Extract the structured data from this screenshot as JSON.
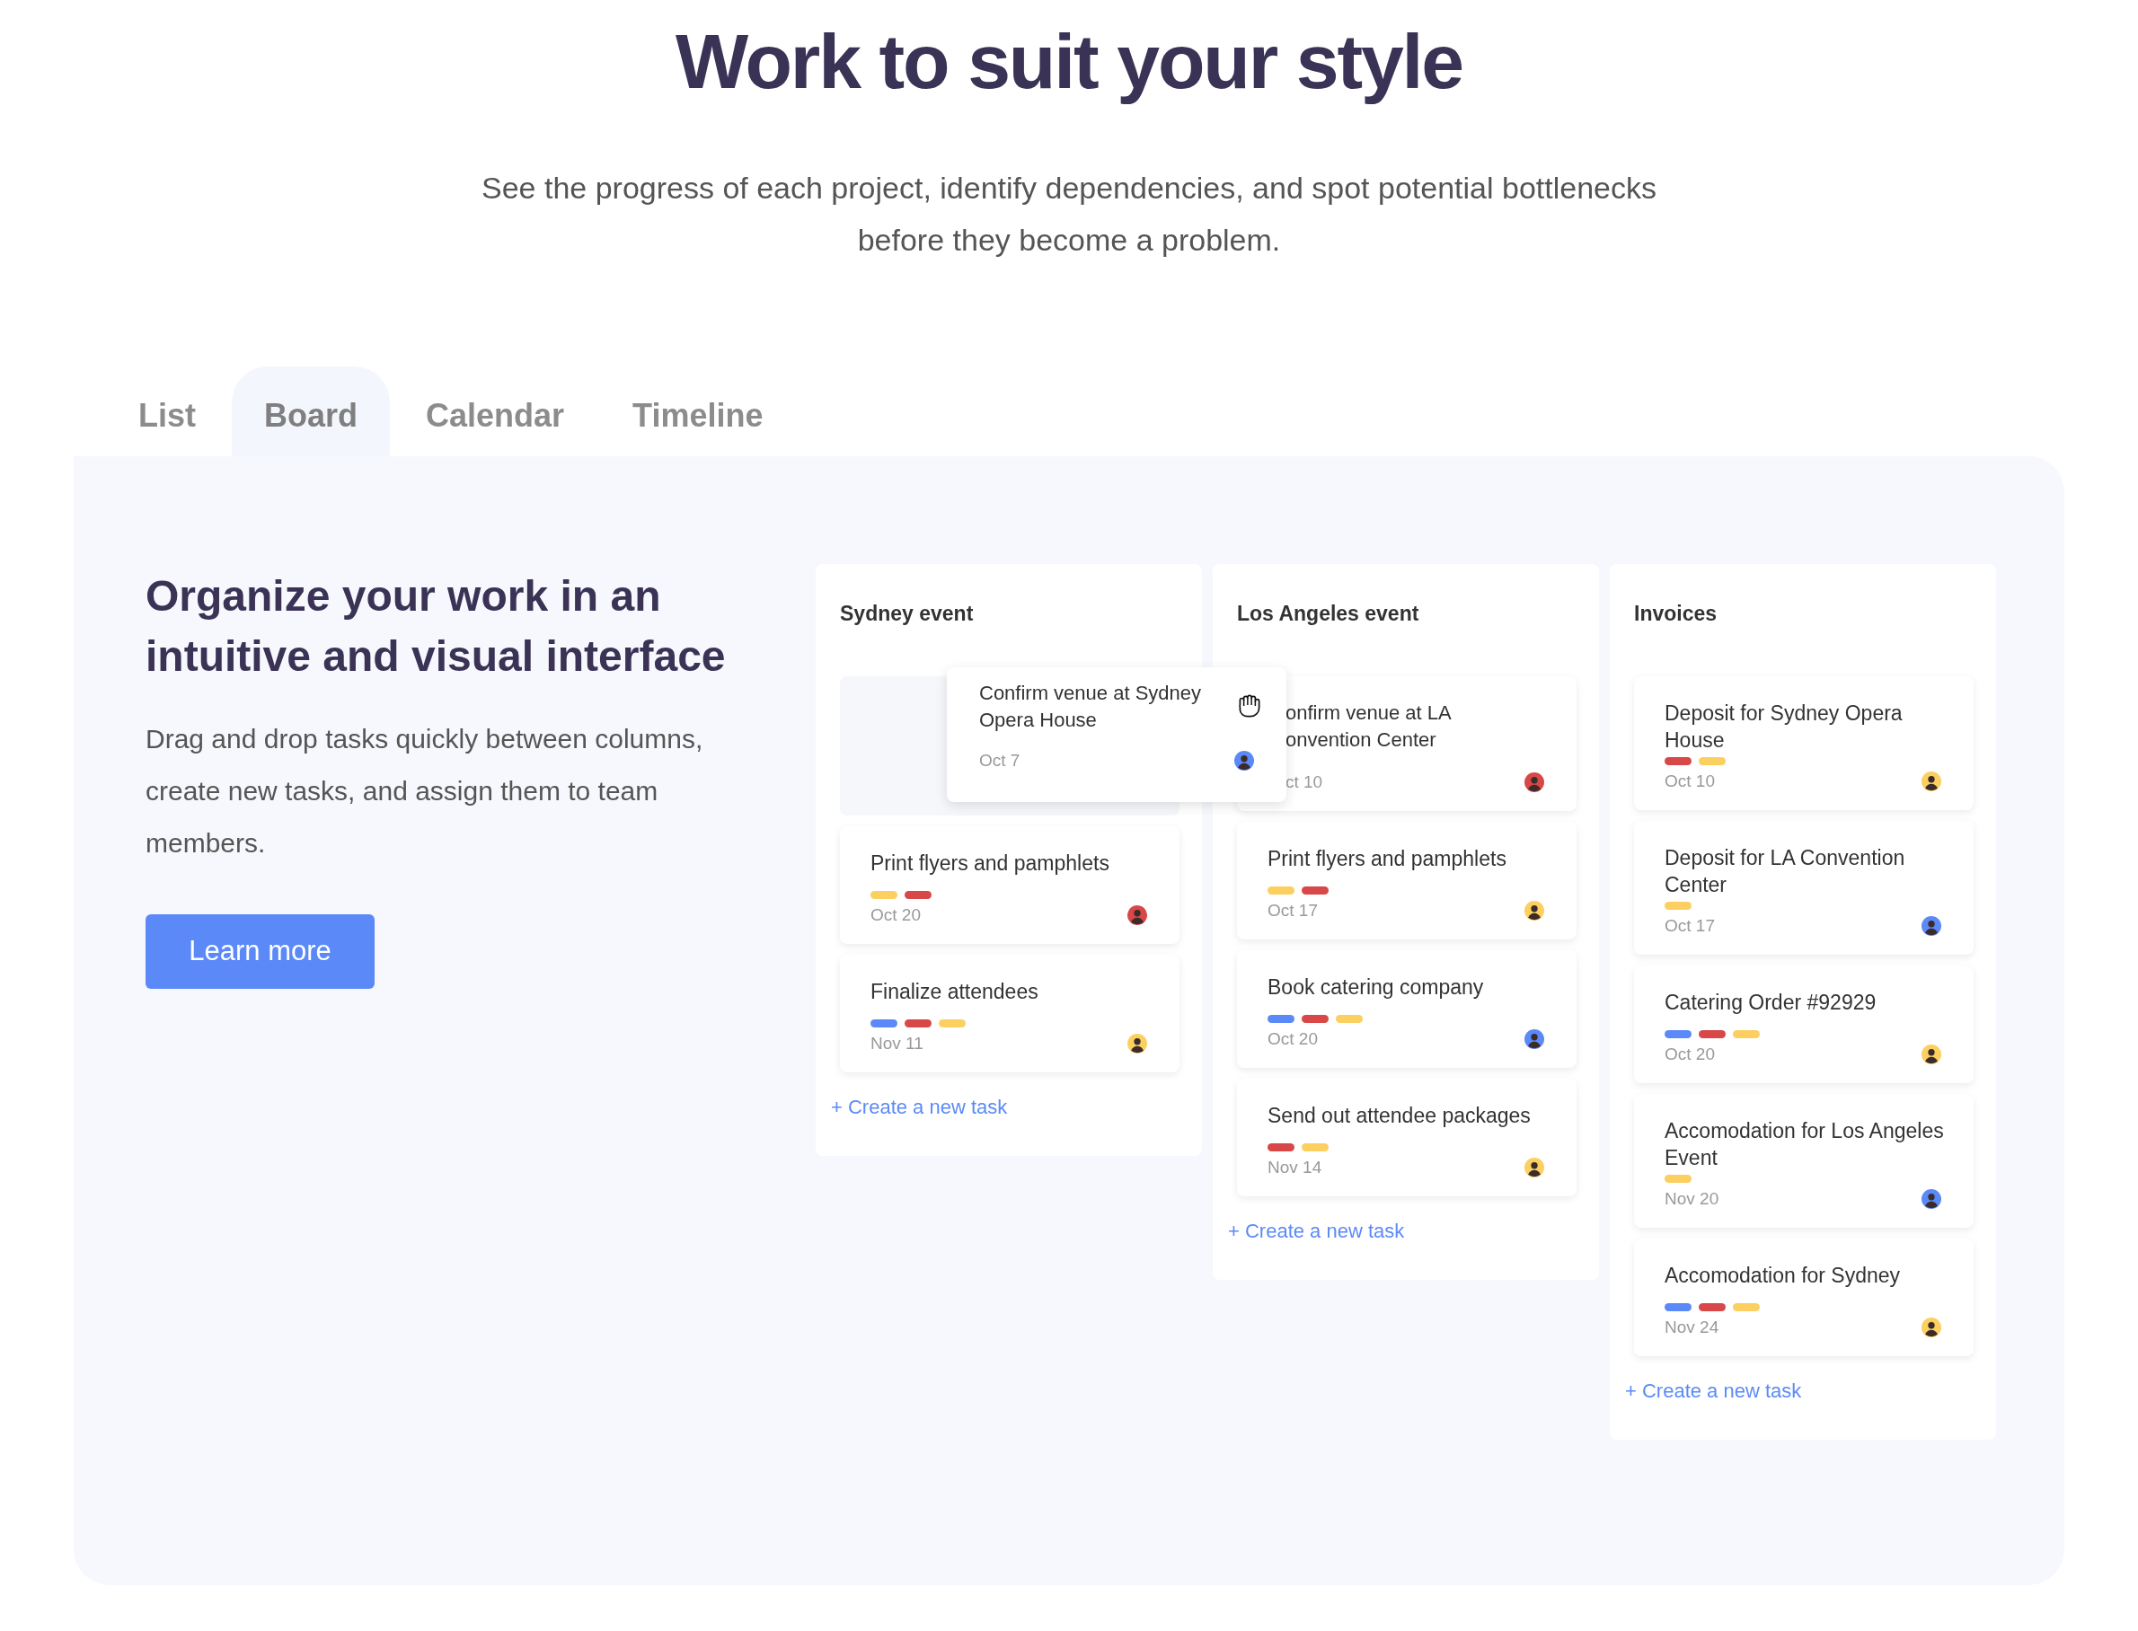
{
  "title": "Work to suit your style",
  "subtitle": "See the progress of each project, identify dependencies, and spot potential bottlenecks before they become a problem.",
  "tabs": [
    {
      "label": "List",
      "selected": false
    },
    {
      "label": "Board",
      "selected": true
    },
    {
      "label": "Calendar",
      "selected": false
    },
    {
      "label": "Timeline",
      "selected": false
    }
  ],
  "intro": {
    "heading": "Organize your work in an intuitive and visual interface",
    "body": "Drag and drop tasks quickly between columns, create new tasks, and assign them to team members.",
    "button": "Learn more"
  },
  "columns": [
    {
      "title": "Sydney event",
      "create": "+ Create a new task",
      "tasks": [
        {
          "kind": "placeholder",
          "card": {
            "title": "Confirm venue at Sydney Opera House",
            "date": "Oct 7",
            "avatar": {
              "color": "#5b8af8"
            }
          }
        },
        {
          "kind": "task",
          "title": "Print flyers and pamphlets",
          "tags": [
            {
              "color": "#fcd060"
            },
            {
              "color": "#d84848"
            }
          ],
          "date": "Oct 20",
          "avatar": {
            "color": "#d84848"
          }
        },
        {
          "kind": "task",
          "title": "Finalize attendees",
          "tags": [
            {
              "color": "#5b8af8"
            },
            {
              "color": "#d84848"
            },
            {
              "color": "#fcd060"
            }
          ],
          "date": "Nov 11",
          "avatar": {
            "color": "#fcd060"
          }
        }
      ]
    },
    {
      "title": "Los Angeles event",
      "create": "+ Create a new task",
      "tasks": [
        {
          "kind": "covered",
          "title": "onfirm venue at LA onvention Center",
          "date": "ct 10",
          "avatar": {
            "color": "#d84848"
          }
        },
        {
          "kind": "task",
          "title": "Print flyers and pamphlets",
          "tags": [
            {
              "color": "#fcd060"
            },
            {
              "color": "#d84848"
            }
          ],
          "date": "Oct 17",
          "avatar": {
            "color": "#fcd060"
          }
        },
        {
          "kind": "task",
          "title": "Book catering company",
          "tags": [
            {
              "color": "#5b8af8"
            },
            {
              "color": "#d84848"
            },
            {
              "color": "#fcd060"
            }
          ],
          "date": "Oct 20",
          "avatar": {
            "color": "#5b8af8"
          }
        },
        {
          "kind": "task",
          "title": "Send out attendee packages",
          "tags": [
            {
              "color": "#d84848"
            },
            {
              "color": "#fcd060"
            }
          ],
          "date": "Nov 14",
          "avatar": {
            "color": "#fcd060"
          }
        }
      ]
    },
    {
      "title": "Invoices",
      "create": "+ Create a new task",
      "tasks": [
        {
          "kind": "task",
          "title": "Deposit for Sydney Opera House",
          "tags": [
            {
              "color": "#d84848"
            },
            {
              "color": "#fcd060"
            }
          ],
          "date": "Oct 10",
          "avatar": {
            "color": "#fcd060"
          }
        },
        {
          "kind": "task",
          "title": "Deposit for LA Convention Center",
          "tags": [
            {
              "color": "#fcd060"
            }
          ],
          "date": "Oct 17",
          "avatar": {
            "color": "#5b8af8"
          }
        },
        {
          "kind": "task",
          "title": "Catering Order #92929",
          "tags": [
            {
              "color": "#5b8af8"
            },
            {
              "color": "#d84848"
            },
            {
              "color": "#fcd060"
            }
          ],
          "date": "Oct 20",
          "avatar": {
            "color": "#fcd060"
          }
        },
        {
          "kind": "task",
          "title": "Accomodation for Los Angeles Event",
          "tags": [
            {
              "color": "#fcd060"
            }
          ],
          "date": "Nov 20",
          "avatar": {
            "color": "#5b8af8"
          }
        },
        {
          "kind": "task",
          "title": "Accomodation for Sydney",
          "tags": [
            {
              "color": "#5b8af8"
            },
            {
              "color": "#d84848"
            },
            {
              "color": "#fcd060"
            }
          ],
          "date": "Nov 24",
          "avatar": {
            "color": "#fcd060"
          }
        }
      ]
    }
  ]
}
